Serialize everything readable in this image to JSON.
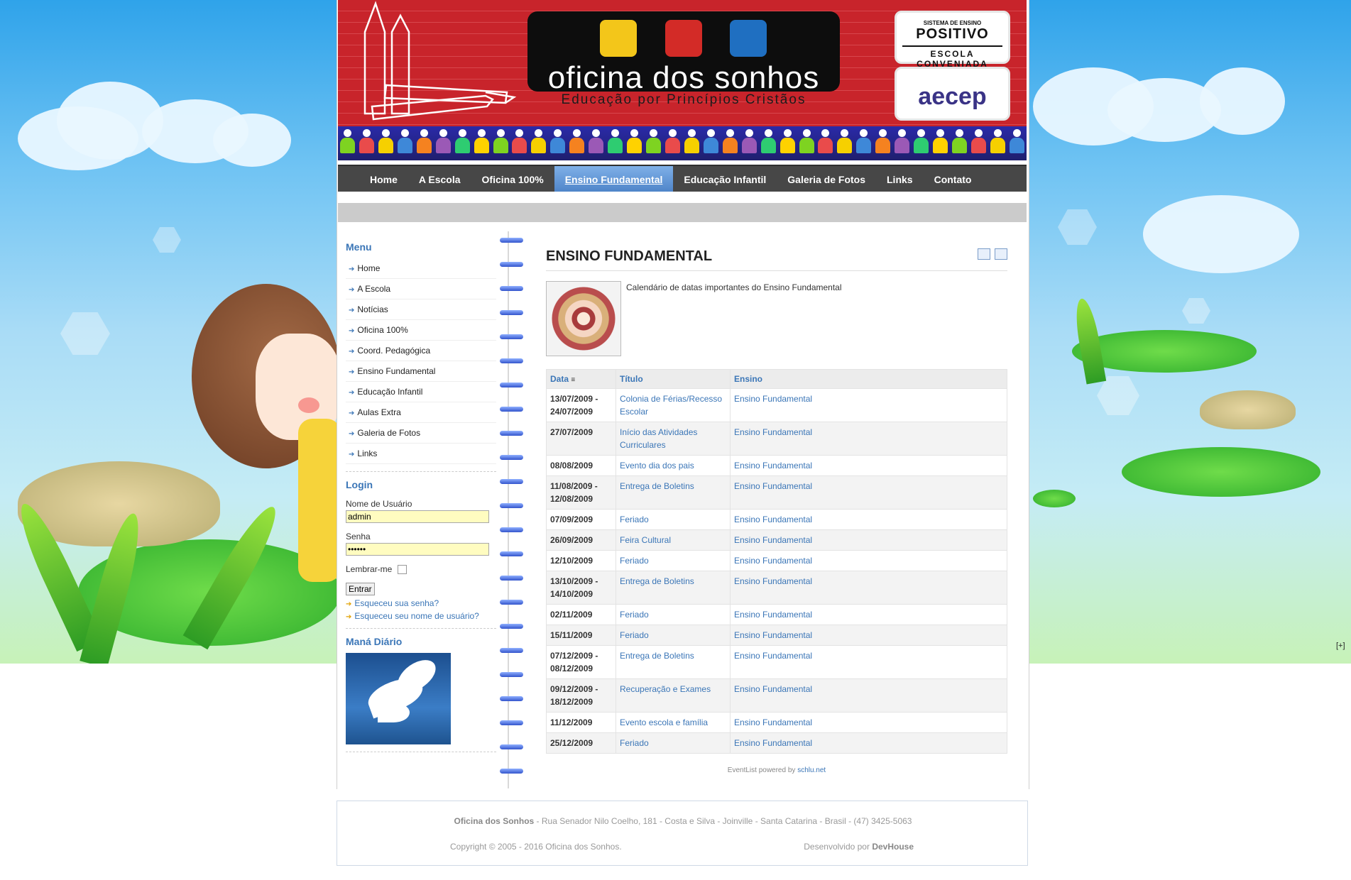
{
  "header": {
    "brand_name": "oficina dos sonhos",
    "brand_tagline": "Educação por Princípios Cristãos",
    "partner1": {
      "line1": "SISTEMA DE ENSINO",
      "line2": "POSITIVO",
      "line3": "ESCOLA CONVENIADA"
    },
    "partner2": {
      "name": "aecep"
    }
  },
  "nav": {
    "items": [
      "Home",
      "A Escola",
      "Oficina 100%",
      "Ensino Fundamental",
      "Educação Infantil",
      "Galeria de Fotos",
      "Links",
      "Contato"
    ],
    "active": "Ensino Fundamental"
  },
  "sidebar": {
    "menu_title": "Menu",
    "menu_items": [
      "Home",
      "A Escola",
      "Notícias",
      "Oficina 100%",
      "Coord. Pedagógica",
      "Ensino Fundamental",
      "Educação Infantil",
      "Aulas Extra",
      "Galeria de Fotos",
      "Links"
    ],
    "login": {
      "title": "Login",
      "username_label": "Nome de Usuário",
      "username_value": "admin",
      "password_label": "Senha",
      "password_value": "••••••",
      "remember_label": "Lembrar-me",
      "submit_label": "Entrar",
      "forgot_password": "Esqueceu sua senha?",
      "forgot_username": "Esqueceu seu nome de usuário?"
    },
    "mana_title": "Maná Diário"
  },
  "content": {
    "title": "ENSINO FUNDAMENTAL",
    "intro": "Calendário de datas importantes do Ensino Fundamental",
    "table": {
      "headers": [
        "Data",
        "Título",
        "Ensino"
      ],
      "rows": [
        {
          "date": "13/07/2009 -\n24/07/2009",
          "title": "Colonia de Férias/Recesso Escolar",
          "ensino": "Ensino Fundamental"
        },
        {
          "date": "27/07/2009",
          "title": "Início das Atividades Curriculares",
          "ensino": "Ensino Fundamental"
        },
        {
          "date": "08/08/2009",
          "title": "Evento dia dos pais",
          "ensino": "Ensino Fundamental"
        },
        {
          "date": "11/08/2009 -\n12/08/2009",
          "title": "Entrega de Boletins",
          "ensino": "Ensino Fundamental"
        },
        {
          "date": "07/09/2009",
          "title": "Feriado",
          "ensino": "Ensino Fundamental"
        },
        {
          "date": "26/09/2009",
          "title": "Feira Cultural",
          "ensino": "Ensino Fundamental"
        },
        {
          "date": "12/10/2009",
          "title": "Feriado",
          "ensino": "Ensino Fundamental"
        },
        {
          "date": "13/10/2009 -\n14/10/2009",
          "title": "Entrega de Boletins",
          "ensino": "Ensino Fundamental"
        },
        {
          "date": "02/11/2009",
          "title": "Feriado",
          "ensino": "Ensino Fundamental"
        },
        {
          "date": "15/11/2009",
          "title": "Feriado",
          "ensino": "Ensino Fundamental"
        },
        {
          "date": "07/12/2009 -\n08/12/2009",
          "title": "Entrega de Boletins",
          "ensino": "Ensino Fundamental"
        },
        {
          "date": "09/12/2009 -\n18/12/2009",
          "title": "Recuperação e Exames",
          "ensino": "Ensino Fundamental"
        },
        {
          "date": "11/12/2009",
          "title": "Evento escola e família",
          "ensino": "Ensino Fundamental"
        },
        {
          "date": "25/12/2009",
          "title": "Feriado",
          "ensino": "Ensino Fundamental"
        }
      ]
    },
    "powered_by_prefix": "EventList powered by",
    "powered_by_link": "schlu.net"
  },
  "footer": {
    "school_name": "Oficina dos Sonhos",
    "address": " - Rua Senador Nilo Coelho, 181 - Costa e Silva - Joinville - Santa Catarina - Brasil - (47) 3425-5063",
    "copyright": "Copyright © 2005 - 2016 Oficina dos Sonhos.",
    "developed_prefix": "Desenvolvido por ",
    "developer": "DevHouse"
  },
  "expand_toggle": "[+]",
  "colors": {
    "header_red": "#c8242b",
    "nav_bg": "#474747",
    "nav_active": "#5f93d4",
    "link": "#3b76b7"
  }
}
